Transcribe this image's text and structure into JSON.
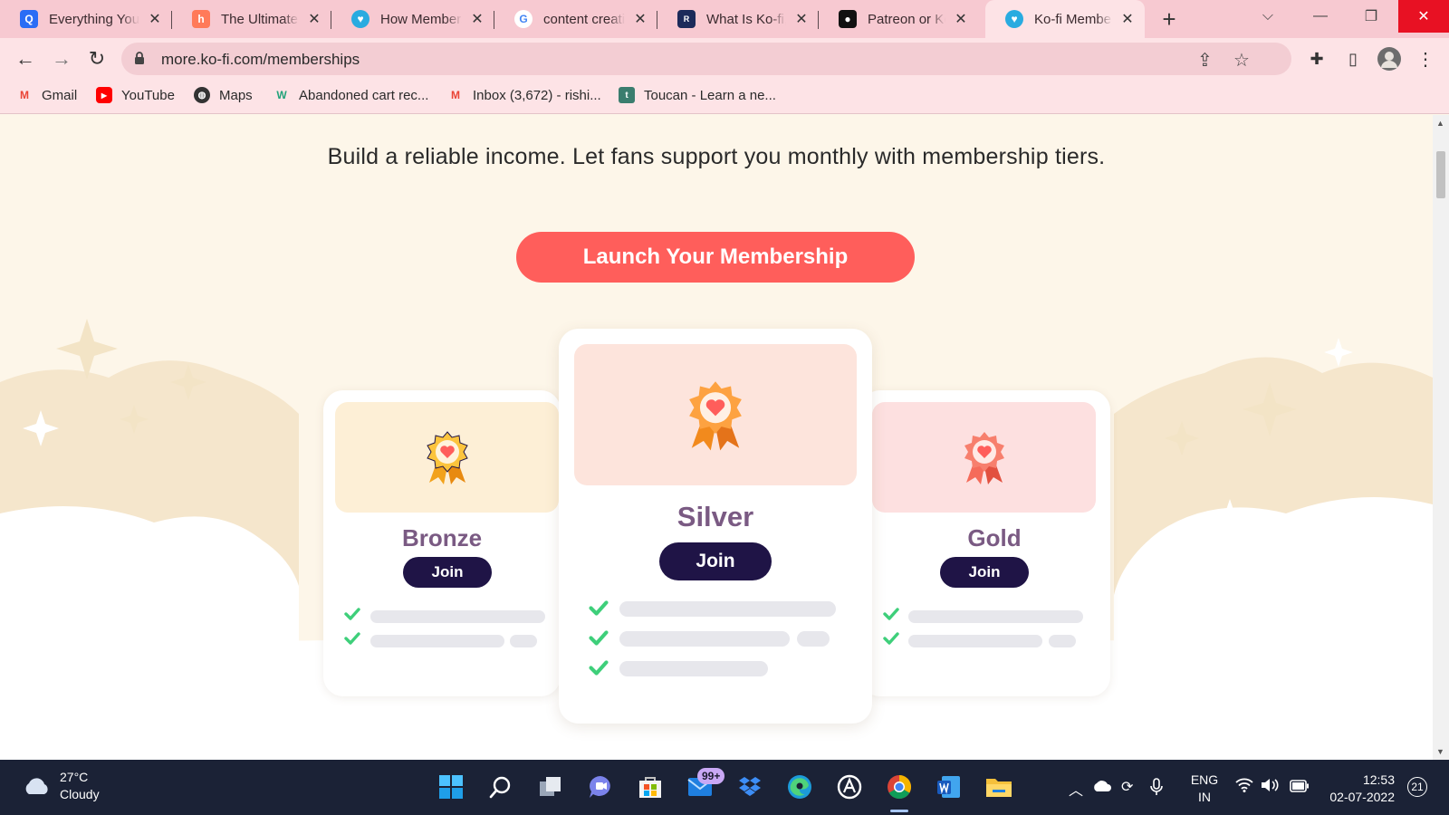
{
  "browser": {
    "tabs": [
      {
        "title": "Everything You Need",
        "favicon": "q-icon",
        "fav_bg": "#2b6df5",
        "fav_text": "Q"
      },
      {
        "title": "The Ultimate Guide",
        "favicon": "hubspot-icon",
        "fav_bg": "#ff7a59",
        "fav_text": "h"
      },
      {
        "title": "How Memberships",
        "favicon": "kofi-icon",
        "fav_bg": "#29abe0",
        "fav_text": "♥"
      },
      {
        "title": "content creation",
        "favicon": "google-icon",
        "fav_bg": "#ffffff",
        "fav_text": "G"
      },
      {
        "title": "What Is Ko-fi, and",
        "favicon": "review-icon",
        "fav_bg": "#1c2a5a",
        "fav_text": "R"
      },
      {
        "title": "Patreon or Ko-fi",
        "favicon": "medium-icon",
        "fav_bg": "#111111",
        "fav_text": "M"
      },
      {
        "title": "Ko-fi Memberships",
        "favicon": "kofi-icon",
        "fav_bg": "#29abe0",
        "fav_text": "♥"
      }
    ],
    "new_tab": "+",
    "url": "more.ko-fi.com/memberships",
    "bookmarks": [
      {
        "label": "Gmail",
        "icon": "gmail-icon"
      },
      {
        "label": "YouTube",
        "icon": "youtube-icon"
      },
      {
        "label": "Maps",
        "icon": "globe-icon"
      },
      {
        "label": "Abandoned cart rec...",
        "icon": "w-icon"
      },
      {
        "label": "Inbox (3,672) - rishi...",
        "icon": "gmail-icon"
      },
      {
        "label": "Toucan - Learn a ne...",
        "icon": "toucan-icon"
      }
    ]
  },
  "page": {
    "subtitle": "Build a reliable income. Let fans support you monthly with membership tiers.",
    "cta": "Launch Your Membership",
    "accent": "#ff5e5b",
    "tiers": [
      {
        "name": "Bronze",
        "join": "Join",
        "hero_color": "#fdefd6"
      },
      {
        "name": "Silver",
        "join": "Join",
        "hero_color": "#fde4dc"
      },
      {
        "name": "Gold",
        "join": "Join",
        "hero_color": "#fde0e0"
      }
    ]
  },
  "taskbar": {
    "weather_temp": "27°C",
    "weather_desc": "Cloudy",
    "mail_badge": "99+",
    "lang_1": "ENG",
    "lang_2": "IN",
    "time": "12:53",
    "date": "02-07-2022",
    "notifications": "21"
  }
}
